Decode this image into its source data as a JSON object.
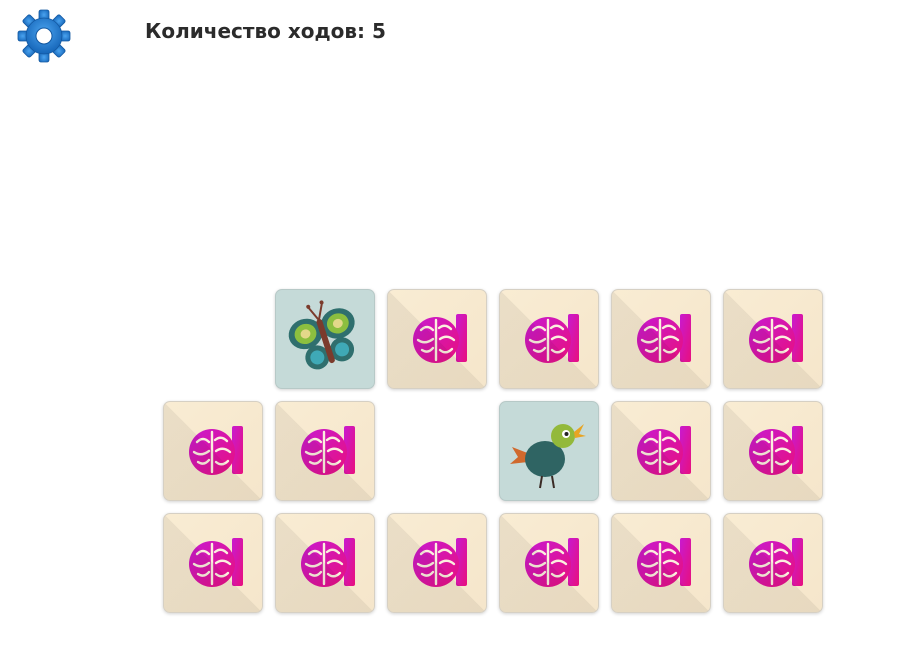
{
  "header": {
    "settings_icon": "gear-icon",
    "moves_text": "Количество ходов: 5"
  },
  "colors": {
    "gear": "#1e7fd4",
    "card_back": "#f7e9cf",
    "card_face": "#c5dad8",
    "logo_pink": "#e8107e"
  },
  "board": {
    "columns": 6,
    "rows": 3,
    "cards": [
      {
        "row": 0,
        "col": 0,
        "state": "removed"
      },
      {
        "row": 0,
        "col": 1,
        "state": "face-up",
        "icon": "butterfly-icon"
      },
      {
        "row": 0,
        "col": 2,
        "state": "face-down",
        "icon": "brain-logo-icon"
      },
      {
        "row": 0,
        "col": 3,
        "state": "face-down",
        "icon": "brain-logo-icon"
      },
      {
        "row": 0,
        "col": 4,
        "state": "face-down",
        "icon": "brain-logo-icon"
      },
      {
        "row": 0,
        "col": 5,
        "state": "face-down",
        "icon": "brain-logo-icon"
      },
      {
        "row": 1,
        "col": 0,
        "state": "face-down",
        "icon": "brain-logo-icon"
      },
      {
        "row": 1,
        "col": 1,
        "state": "face-down",
        "icon": "brain-logo-icon"
      },
      {
        "row": 1,
        "col": 2,
        "state": "removed"
      },
      {
        "row": 1,
        "col": 3,
        "state": "face-up",
        "icon": "bird-icon"
      },
      {
        "row": 1,
        "col": 4,
        "state": "face-down",
        "icon": "brain-logo-icon"
      },
      {
        "row": 1,
        "col": 5,
        "state": "face-down",
        "icon": "brain-logo-icon"
      },
      {
        "row": 2,
        "col": 0,
        "state": "face-down",
        "icon": "brain-logo-icon"
      },
      {
        "row": 2,
        "col": 1,
        "state": "face-down",
        "icon": "brain-logo-icon"
      },
      {
        "row": 2,
        "col": 2,
        "state": "face-down",
        "icon": "brain-logo-icon"
      },
      {
        "row": 2,
        "col": 3,
        "state": "face-down",
        "icon": "brain-logo-icon"
      },
      {
        "row": 2,
        "col": 4,
        "state": "face-down",
        "icon": "brain-logo-icon"
      },
      {
        "row": 2,
        "col": 5,
        "state": "face-down",
        "icon": "brain-logo-icon"
      }
    ]
  }
}
